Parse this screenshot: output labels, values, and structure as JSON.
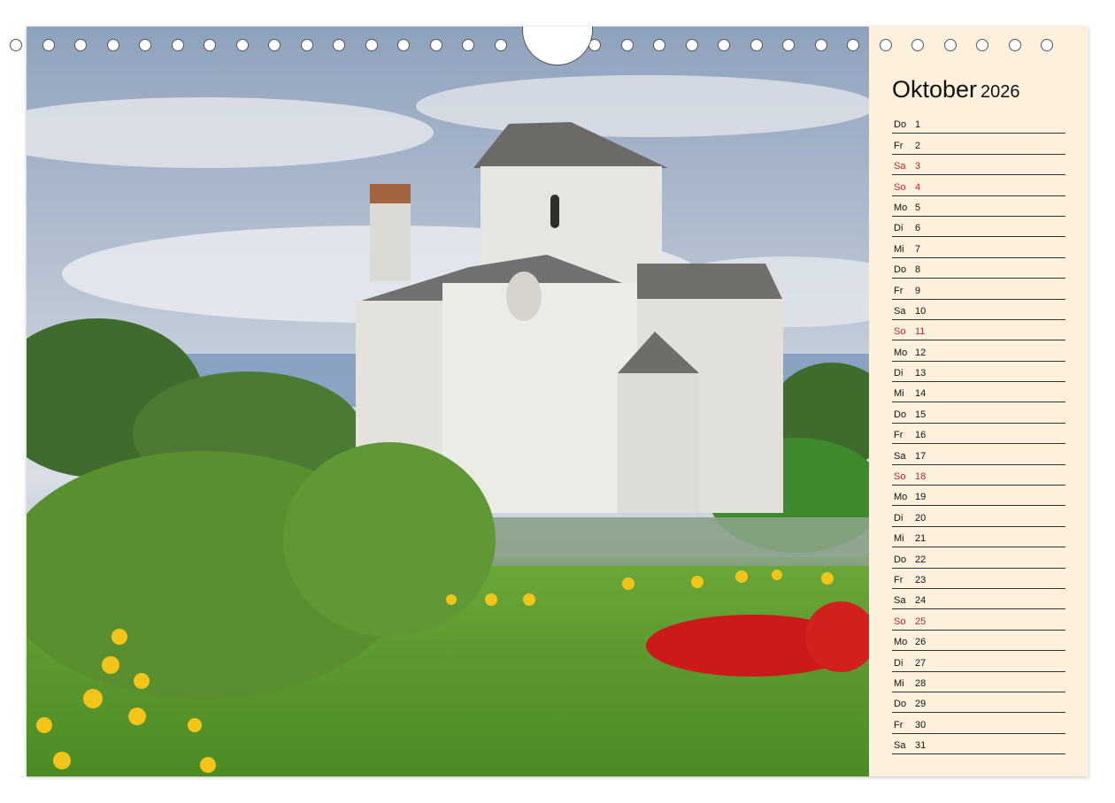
{
  "calendar": {
    "month": "Oktober",
    "year": "2026",
    "days": [
      {
        "wd": "Do",
        "d": "1",
        "sunday": false
      },
      {
        "wd": "Fr",
        "d": "2",
        "sunday": false
      },
      {
        "wd": "Sa",
        "d": "3",
        "sunday": true
      },
      {
        "wd": "So",
        "d": "4",
        "sunday": true
      },
      {
        "wd": "Mo",
        "d": "5",
        "sunday": false
      },
      {
        "wd": "Di",
        "d": "6",
        "sunday": false
      },
      {
        "wd": "Mi",
        "d": "7",
        "sunday": false
      },
      {
        "wd": "Do",
        "d": "8",
        "sunday": false
      },
      {
        "wd": "Fr",
        "d": "9",
        "sunday": false
      },
      {
        "wd": "Sa",
        "d": "10",
        "sunday": false
      },
      {
        "wd": "So",
        "d": "11",
        "sunday": true
      },
      {
        "wd": "Mo",
        "d": "12",
        "sunday": false
      },
      {
        "wd": "Di",
        "d": "13",
        "sunday": false
      },
      {
        "wd": "Mi",
        "d": "14",
        "sunday": false
      },
      {
        "wd": "Do",
        "d": "15",
        "sunday": false
      },
      {
        "wd": "Fr",
        "d": "16",
        "sunday": false
      },
      {
        "wd": "Sa",
        "d": "17",
        "sunday": false
      },
      {
        "wd": "So",
        "d": "18",
        "sunday": true
      },
      {
        "wd": "Mo",
        "d": "19",
        "sunday": false
      },
      {
        "wd": "Di",
        "d": "20",
        "sunday": false
      },
      {
        "wd": "Mi",
        "d": "21",
        "sunday": false
      },
      {
        "wd": "Do",
        "d": "22",
        "sunday": false
      },
      {
        "wd": "Fr",
        "d": "23",
        "sunday": false
      },
      {
        "wd": "Sa",
        "d": "24",
        "sunday": false
      },
      {
        "wd": "So",
        "d": "25",
        "sunday": true
      },
      {
        "wd": "Mo",
        "d": "26",
        "sunday": false
      },
      {
        "wd": "Di",
        "d": "27",
        "sunday": false
      },
      {
        "wd": "Mi",
        "d": "28",
        "sunday": false
      },
      {
        "wd": "Do",
        "d": "29",
        "sunday": false
      },
      {
        "wd": "Fr",
        "d": "30",
        "sunday": false
      },
      {
        "wd": "Sa",
        "d": "31",
        "sunday": false
      }
    ]
  },
  "colors": {
    "panel_bg": "#fdf0dc",
    "sunday_text": "#c0262d",
    "rule": "#333333"
  }
}
